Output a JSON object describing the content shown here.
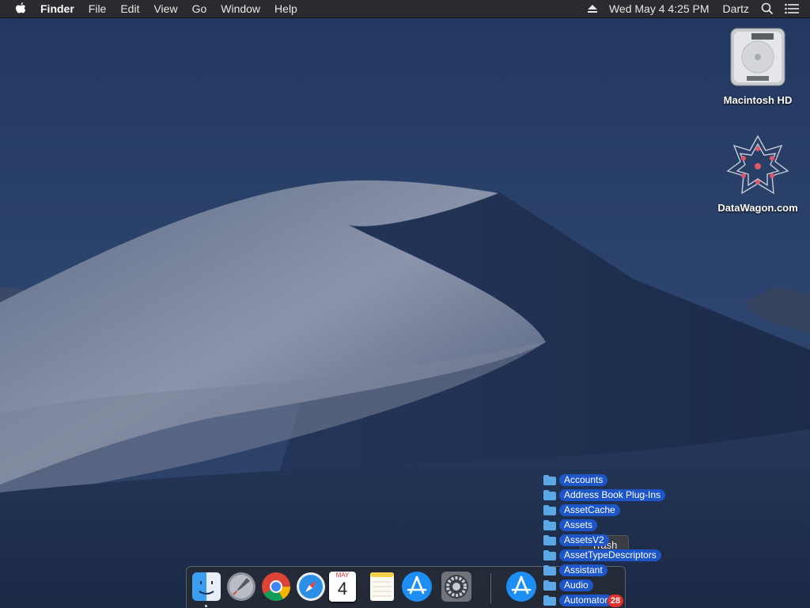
{
  "menubar": {
    "app_name": "Finder",
    "menus": [
      "File",
      "Edit",
      "View",
      "Go",
      "Window",
      "Help"
    ],
    "clock": "Wed May 4  4:25 PM",
    "user": "Dartz"
  },
  "desktop_icons": [
    {
      "label": "Macintosh HD",
      "icon": "hard-drive-icon"
    },
    {
      "label": "DataWagon.com",
      "icon": "datawagon-icon"
    }
  ],
  "dock": {
    "apps": [
      {
        "name": "Finder",
        "icon": "finder-icon",
        "running": true
      },
      {
        "name": "Launchpad",
        "icon": "launchpad-icon",
        "running": false
      },
      {
        "name": "Chrome",
        "icon": "chrome-icon",
        "running": false
      },
      {
        "name": "Safari",
        "icon": "safari-icon",
        "running": false
      },
      {
        "name": "Calendar",
        "icon": "calendar-icon",
        "running": false,
        "month": "MAY",
        "day": "4"
      },
      {
        "name": "Notes",
        "icon": "notes-icon",
        "running": false
      },
      {
        "name": "App Store",
        "icon": "app-store-icon",
        "running": false
      },
      {
        "name": "System Preferences",
        "icon": "system-preferences-icon",
        "running": false
      },
      {
        "name": "Applications",
        "icon": "app-store-icon",
        "running": false
      }
    ]
  },
  "stack": {
    "items": [
      "Accounts",
      "Address Book Plug-Ins",
      "AssetCache",
      "Assets",
      "AssetsV2",
      "AssetTypeDescriptors",
      "Assistant",
      "Audio",
      "Automator"
    ],
    "badge": "28"
  },
  "tooltip": "Trash",
  "colors": {
    "selection": "#1d56c9",
    "badge": "#e0312b",
    "menubar": "#2a2b2e"
  }
}
